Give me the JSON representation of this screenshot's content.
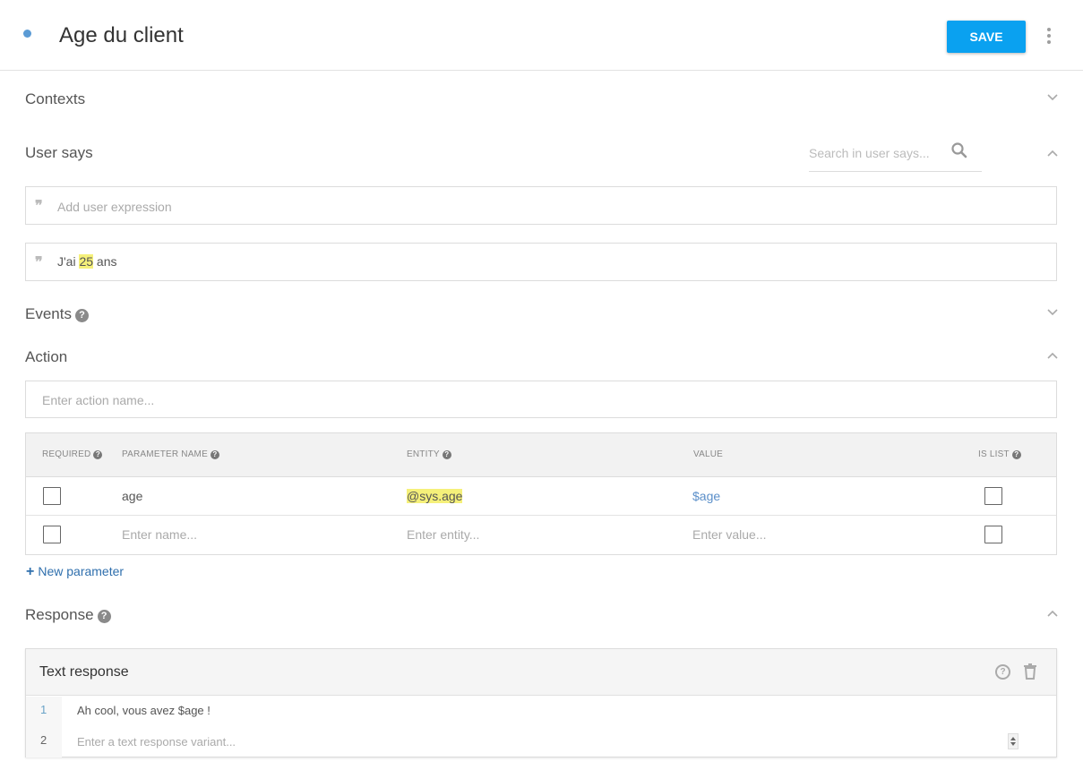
{
  "header": {
    "title": "Age du client",
    "save_label": "SAVE"
  },
  "sections": {
    "contexts": "Contexts",
    "user_says": "User says",
    "events": "Events",
    "action": "Action",
    "response": "Response"
  },
  "search": {
    "placeholder": "Search in user says..."
  },
  "user_says": {
    "add_placeholder": "Add user expression",
    "expressions": [
      {
        "prefix": "J'ai ",
        "highlight": "25",
        "suffix": " ans"
      }
    ]
  },
  "action": {
    "name_placeholder": "Enter action name..."
  },
  "parameters": {
    "headers": {
      "required": "REQUIRED",
      "name": "PARAMETER NAME",
      "entity": "ENTITY",
      "value": "VALUE",
      "is_list": "IS LIST"
    },
    "rows": [
      {
        "required": false,
        "name": "age",
        "entity": "@sys.age",
        "value": "$age",
        "is_list": false
      }
    ],
    "new_row": {
      "name_placeholder": "Enter name...",
      "entity_placeholder": "Enter entity...",
      "value_placeholder": "Enter value..."
    },
    "new_parameter_label": "New parameter"
  },
  "text_response": {
    "title": "Text response",
    "line_numbers": [
      "1",
      "2"
    ],
    "lines": [
      "Ah cool, vous avez $age !"
    ],
    "variant_placeholder": "Enter a text response variant..."
  },
  "colors": {
    "accent": "#0aa1f0",
    "highlight": "#f5f07a",
    "link": "#2f6fad"
  }
}
